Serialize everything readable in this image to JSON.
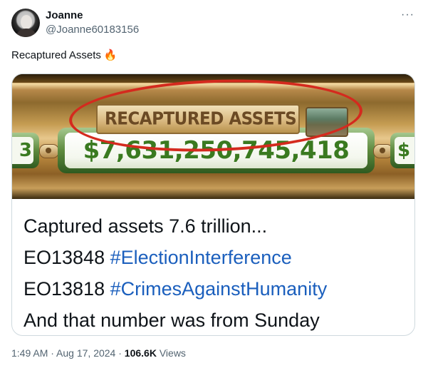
{
  "author": {
    "name": "Joanne",
    "handle": "@Joanne60183156"
  },
  "more_label": "···",
  "tweet": {
    "text": "Recaptured Assets",
    "emoji": "🔥"
  },
  "image": {
    "label": "RECAPTURED ASSETS",
    "counter": "$7,631,250,745,418",
    "left_partial": "3",
    "right_partial": "$",
    "annotation_color": "#d42a1e"
  },
  "card_text": {
    "line1": "Captured assets 7.6 trillion...",
    "line2_prefix": "EO13848 ",
    "line2_hashtag": "#ElectionInterference",
    "line3_prefix": "EO13818 ",
    "line3_hashtag": "#CrimesAgainstHumanity",
    "line4": "And that number was from Sunday"
  },
  "meta": {
    "time": "1:49 AM",
    "separator1": " · ",
    "date": "Aug 17, 2024",
    "separator2": " · ",
    "views_count": "106.6K",
    "views_label": " Views"
  },
  "colors": {
    "hashtag": "#1b5fbd",
    "muted": "#536471",
    "text": "#0f1419"
  }
}
